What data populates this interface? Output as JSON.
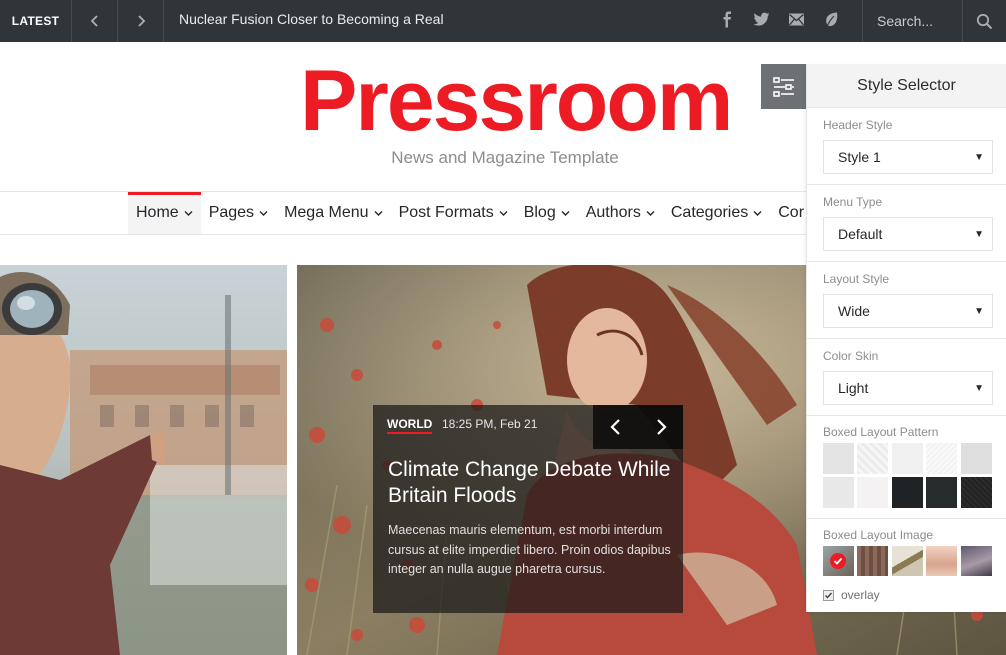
{
  "topbar": {
    "latest_label": "LATEST",
    "ticker_text": "Nuclear Fusion Closer to Becoming a Real",
    "social_icons": [
      "facebook-icon",
      "twitter-icon",
      "email-icon",
      "leaf-icon"
    ],
    "search_placeholder": "Search..."
  },
  "header": {
    "logo": "Pressroom",
    "tagline": "News and Magazine Template"
  },
  "menu": {
    "items": [
      {
        "label": "Home",
        "active": true
      },
      {
        "label": "Pages"
      },
      {
        "label": "Mega Menu"
      },
      {
        "label": "Post Formats"
      },
      {
        "label": "Blog"
      },
      {
        "label": "Authors"
      },
      {
        "label": "Categories"
      },
      {
        "label": "Cor"
      }
    ]
  },
  "slide": {
    "category": "WORLD",
    "date": "18:25 PM, Feb 21",
    "title": "Climate Change Debate While Britain Floods",
    "excerpt": "Maecenas mauris elementum, est morbi interdum cursus at elite imperdiet libero. Proin odios dapibus integer an nulla augue pharetra cursus."
  },
  "style_selector": {
    "title": "Style Selector",
    "header_style": {
      "label": "Header Style",
      "value": "Style 1"
    },
    "menu_type": {
      "label": "Menu Type",
      "value": "Default"
    },
    "layout_style": {
      "label": "Layout Style",
      "value": "Wide"
    },
    "color_skin": {
      "label": "Color Skin",
      "value": "Light"
    },
    "boxed_pattern_label": "Boxed Layout Pattern",
    "boxed_image_label": "Boxed Layout Image",
    "overlay_label": "overlay",
    "overlay_checked": true
  },
  "colors": {
    "accent": "#ed1c24",
    "topbar_bg": "#2f3539"
  }
}
